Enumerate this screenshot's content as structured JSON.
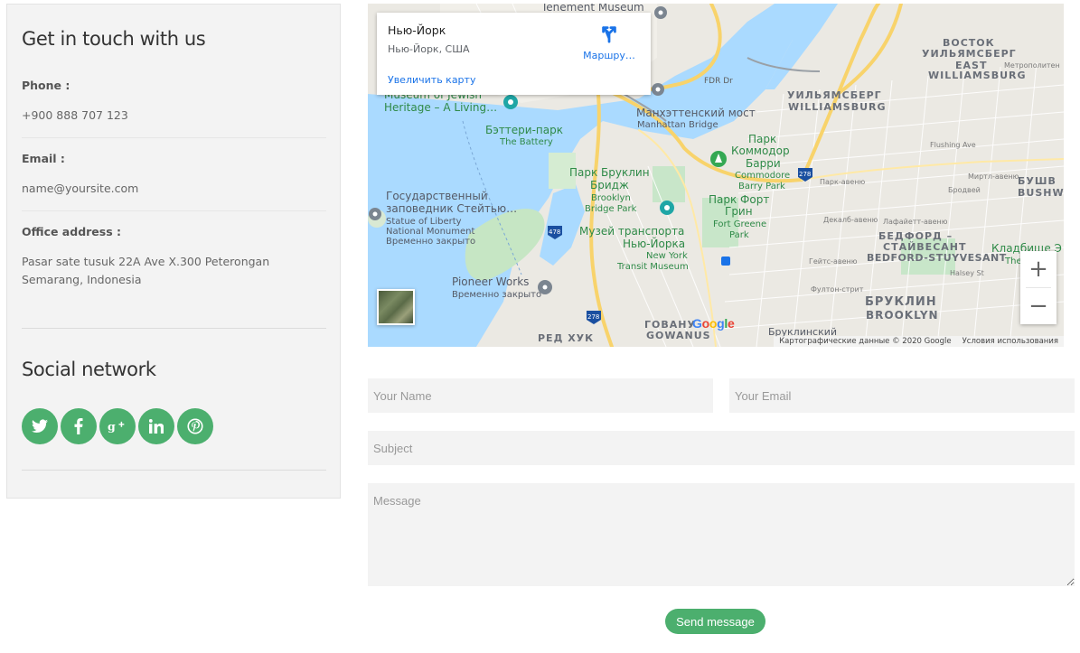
{
  "contact": {
    "title": "Get in touch with us",
    "phone": {
      "label": "Phone :",
      "value": "+900 888 707 123"
    },
    "email": {
      "label": "Email :",
      "value": "name@yoursite.com"
    },
    "address": {
      "label": "Office address :",
      "value": "Pasar sate tusuk 22A Ave X.300 Peterongan Semarang, Indonesia"
    },
    "social_title": "Social network",
    "social": [
      {
        "name": "twitter-icon",
        "glyph": "t"
      },
      {
        "name": "facebook-icon",
        "glyph": "f"
      },
      {
        "name": "google-plus-icon",
        "glyph": "g+"
      },
      {
        "name": "linkedin-icon",
        "glyph": "in"
      },
      {
        "name": "pinterest-icon",
        "glyph": "p"
      }
    ]
  },
  "map": {
    "card": {
      "title": "Нью-Йорк",
      "subtitle": "Нью-Йорк, США",
      "link": "Увеличить карту",
      "directions": "Маршру…"
    },
    "zoom_in": "+",
    "zoom_out": "−",
    "logo": "Google",
    "footer_data": "Картографические данные © 2020 Google",
    "footer_terms": "Условия использования",
    "labels": {
      "tenement": "Tenement Museum",
      "vostok1": "ВОСТОК",
      "vostok2": "УИЛЬЯМСБЕРГ",
      "east_w1": "EAST",
      "east_w2": "WILLIAMSBURG",
      "will_ru": "УИЛЬЯМСБЕРГ",
      "will_en": "WILLIAMSBURG",
      "museum_jew1": "Museum of Jewish",
      "museum_jew2": "Heritage – A Living…",
      "manhattan_ru": "Манхэттенский мост",
      "manhattan_en": "Manhattan Bridge",
      "battery_ru": "Бэттери-парк",
      "battery_en": "The Battery",
      "commodore1": "Парк",
      "commodore2": "Коммодор",
      "commodore3": "Барри",
      "commodore_en1": "Commodore",
      "commodore_en2": "Barry Park",
      "bbp1": "Парк Бруклин",
      "bbp2": "Бридж",
      "bbp_en1": "Brooklyn",
      "bbp_en2": "Bridge Park",
      "fort1": "Парк Форт",
      "fort2": "Грин",
      "fort_en1": "Fort Greene",
      "fort_en2": "Park",
      "statue1": "Государственный",
      "statue2": "заповедник Стейтью…",
      "statue_en1": "Statue of Liberty",
      "statue_en2": "National Monument",
      "statue_closed": "Временно закрыто",
      "transit1": "Музей транспорта",
      "transit2": "Нью-Йорка",
      "transit_en1": "New York",
      "transit_en2": "Transit Museum",
      "bedford1": "БЕДФОРД –",
      "bedford2": "СТАЙВЕСАНТ",
      "bedford_en": "BEDFORD-STUYVESANT",
      "kladb": "Кладбище Э",
      "kladb_en": "The",
      "bushwick_ru": "БУШВ",
      "bushwick_en": "BUSHWIC",
      "pioneer": "Pioneer Works",
      "pioneer_closed": "Временно закрыто",
      "brooklyn_ru": "БРУКЛИН",
      "brooklyn_en": "BROOKLYN",
      "gowanus_ru": "ГОВАНУ",
      "gowanus_en": "GOWANUS",
      "redhook": "РЕД ХУК",
      "brooklinsky": "Бруклинский",
      "fdr": "FDR Dr",
      "metropolitan": "Метрополитен",
      "flushing": "Flushing Ave",
      "myrtle": "Миртл-авеню",
      "park_ave": "Парк-авеню",
      "dekalb": "Декалб-авеню",
      "lafayette": "Лафайетт-авеню",
      "gates": "Гейтс-авеню",
      "fulton": "Фултон-стрит",
      "halsey": "Halsey St",
      "broadway": "Бродвей",
      "shield_278a": "278",
      "shield_278b": "278",
      "shield_478": "478"
    }
  },
  "form": {
    "name_placeholder": "Your Name",
    "email_placeholder": "Your Email",
    "subject_placeholder": "Subject",
    "message_placeholder": "Message",
    "send_label": "Send message"
  },
  "colors": {
    "accent": "#4caf6e",
    "panel_bg": "#f3f3f3",
    "water": "#aadaff",
    "park": "#c8e6c9"
  }
}
